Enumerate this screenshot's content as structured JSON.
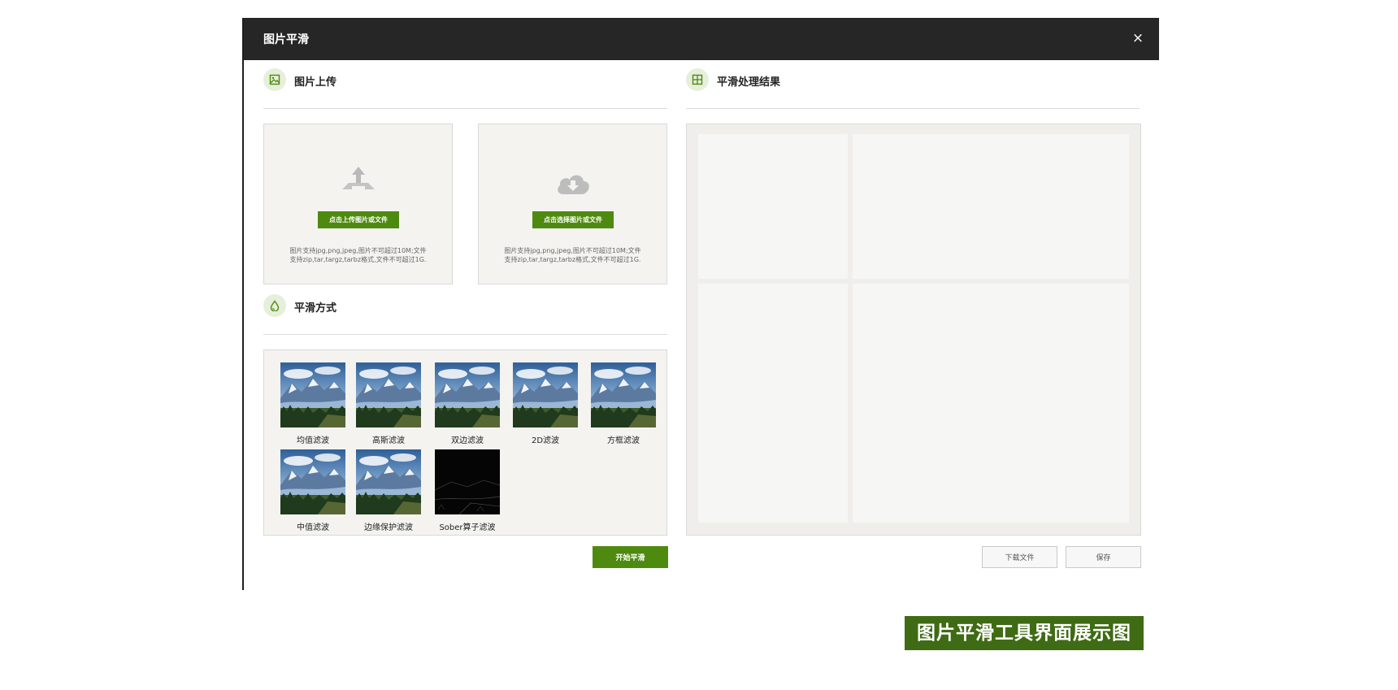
{
  "dialog": {
    "title": "图片平滑",
    "close_glyph": "×"
  },
  "upload_section": {
    "title": "图片上传",
    "upload_card": {
      "button": "点击上传图片或文件",
      "hint_line1": "图片支持jpg,png,jpeg,图片不可超过10M;文件",
      "hint_line2": "支持zip,tar,targz,tarbz格式,文件不可超过1G."
    },
    "select_card": {
      "button": "点击选择图片或文件",
      "hint_line1": "图片支持jpg,png,jpeg,图片不可超过10M;文件",
      "hint_line2": "支持zip,tar,targz,tarbz格式,文件不可超过1G."
    }
  },
  "method_section": {
    "title": "平滑方式",
    "methods": [
      "均值滤波",
      "高斯滤波",
      "双边滤波",
      "2D滤波",
      "方框滤波",
      "中值滤波",
      "边缘保护滤波",
      "Sober算子滤波"
    ]
  },
  "result_section": {
    "title": "平滑处理结果"
  },
  "actions": {
    "start": "开始平滑",
    "download": "下载文件",
    "save": "保存"
  },
  "caption": "图片平滑工具界面展示图",
  "colors": {
    "accent": "#4e8a0f",
    "titlebar": "#262626",
    "caption_bg": "#3f6b14"
  }
}
